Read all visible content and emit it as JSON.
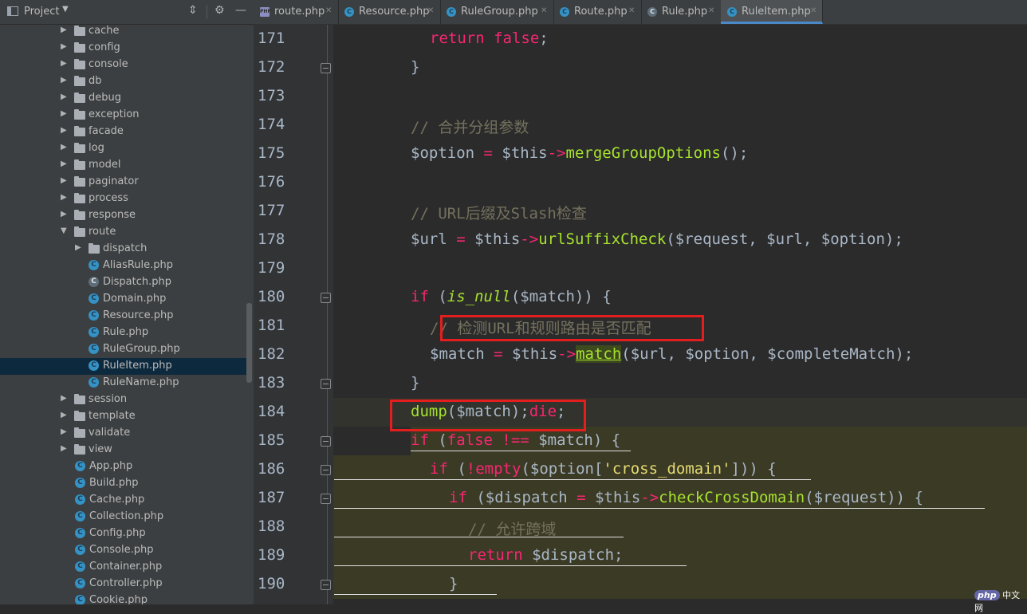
{
  "project": {
    "title": "Project",
    "tree": [
      {
        "type": "folder",
        "label": "cache",
        "depth": 0,
        "collapsed": true
      },
      {
        "type": "folder",
        "label": "config",
        "depth": 0,
        "collapsed": true
      },
      {
        "type": "folder",
        "label": "console",
        "depth": 0,
        "collapsed": true
      },
      {
        "type": "folder",
        "label": "db",
        "depth": 0,
        "collapsed": true
      },
      {
        "type": "folder",
        "label": "debug",
        "depth": 0,
        "collapsed": true
      },
      {
        "type": "folder",
        "label": "exception",
        "depth": 0,
        "collapsed": true
      },
      {
        "type": "folder",
        "label": "facade",
        "depth": 0,
        "collapsed": true
      },
      {
        "type": "folder",
        "label": "log",
        "depth": 0,
        "collapsed": true
      },
      {
        "type": "folder",
        "label": "model",
        "depth": 0,
        "collapsed": true
      },
      {
        "type": "folder",
        "label": "paginator",
        "depth": 0,
        "collapsed": true
      },
      {
        "type": "folder",
        "label": "process",
        "depth": 0,
        "collapsed": true
      },
      {
        "type": "folder",
        "label": "response",
        "depth": 0,
        "collapsed": true
      },
      {
        "type": "folder",
        "label": "route",
        "depth": 0,
        "collapsed": false
      },
      {
        "type": "folder",
        "label": "dispatch",
        "depth": 1,
        "collapsed": true
      },
      {
        "type": "class",
        "label": "AliasRule.php",
        "depth": 1
      },
      {
        "type": "abstract",
        "label": "Dispatch.php",
        "depth": 1
      },
      {
        "type": "class",
        "label": "Domain.php",
        "depth": 1
      },
      {
        "type": "class",
        "label": "Resource.php",
        "depth": 1
      },
      {
        "type": "class",
        "label": "Rule.php",
        "depth": 1
      },
      {
        "type": "class",
        "label": "RuleGroup.php",
        "depth": 1
      },
      {
        "type": "class",
        "label": "RuleItem.php",
        "depth": 1,
        "selected": true
      },
      {
        "type": "class",
        "label": "RuleName.php",
        "depth": 1
      },
      {
        "type": "folder",
        "label": "session",
        "depth": 0,
        "collapsed": true
      },
      {
        "type": "folder",
        "label": "template",
        "depth": 0,
        "collapsed": true
      },
      {
        "type": "folder",
        "label": "validate",
        "depth": 0,
        "collapsed": true
      },
      {
        "type": "folder",
        "label": "view",
        "depth": 0,
        "collapsed": true
      },
      {
        "type": "class",
        "label": "App.php",
        "depth": 0,
        "file": true
      },
      {
        "type": "class",
        "label": "Build.php",
        "depth": 0,
        "file": true
      },
      {
        "type": "class",
        "label": "Cache.php",
        "depth": 0,
        "file": true
      },
      {
        "type": "class",
        "label": "Collection.php",
        "depth": 0,
        "file": true
      },
      {
        "type": "class",
        "label": "Config.php",
        "depth": 0,
        "file": true
      },
      {
        "type": "class",
        "label": "Console.php",
        "depth": 0,
        "file": true
      },
      {
        "type": "class",
        "label": "Container.php",
        "depth": 0,
        "file": true
      },
      {
        "type": "class",
        "label": "Controller.php",
        "depth": 0,
        "file": true
      },
      {
        "type": "class",
        "label": "Cookie.php",
        "depth": 0,
        "file": true
      }
    ]
  },
  "tabs": [
    {
      "label": "route.php",
      "icon": "php-file-icon",
      "active": false
    },
    {
      "label": "Resource.php",
      "icon": "class-icon",
      "active": false
    },
    {
      "label": "RuleGroup.php",
      "icon": "class-icon",
      "active": false
    },
    {
      "label": "Route.php",
      "icon": "class-icon",
      "active": false
    },
    {
      "label": "Rule.php",
      "icon": "abstract-class-icon",
      "active": false
    },
    {
      "label": "RuleItem.php",
      "icon": "class-icon",
      "active": true
    }
  ],
  "editor": {
    "lines": [
      {
        "n": "171",
        "indent": 10,
        "tokens": [
          [
            "kw2",
            "return "
          ],
          [
            "kw2",
            "false"
          ],
          [
            "var",
            ";"
          ]
        ]
      },
      {
        "n": "172",
        "indent": 8,
        "fold": true,
        "tokens": [
          [
            "var",
            "}"
          ]
        ]
      },
      {
        "n": "173",
        "indent": 8,
        "tokens": []
      },
      {
        "n": "174",
        "indent": 8,
        "tokens": [
          [
            "cm",
            "// 合并分组参数"
          ]
        ]
      },
      {
        "n": "175",
        "indent": 8,
        "tokens": [
          [
            "var",
            "$option "
          ],
          [
            "op",
            "= "
          ],
          [
            "var",
            "$this"
          ],
          [
            "op",
            "->"
          ],
          [
            "fn",
            "mergeGroupOptions"
          ],
          [
            "var",
            "();"
          ]
        ]
      },
      {
        "n": "176",
        "indent": 8,
        "tokens": []
      },
      {
        "n": "177",
        "indent": 8,
        "tokens": [
          [
            "cm",
            "// URL后缀及Slash检查"
          ]
        ]
      },
      {
        "n": "178",
        "indent": 8,
        "tokens": [
          [
            "var",
            "$url "
          ],
          [
            "op",
            "= "
          ],
          [
            "var",
            "$this"
          ],
          [
            "op",
            "->"
          ],
          [
            "fn",
            "urlSuffixCheck"
          ],
          [
            "var",
            "($request, $url, $option);"
          ]
        ]
      },
      {
        "n": "179",
        "indent": 8,
        "tokens": []
      },
      {
        "n": "180",
        "indent": 8,
        "fold": true,
        "tokens": [
          [
            "kw2",
            "if "
          ],
          [
            "var",
            "("
          ],
          [
            "fni",
            "is_null"
          ],
          [
            "var",
            "($match)) {"
          ]
        ]
      },
      {
        "n": "181",
        "indent": 10,
        "tokens": [
          [
            "cm",
            "// 检测URL和规则路由是否匹配"
          ]
        ]
      },
      {
        "n": "182",
        "indent": 10,
        "tokens": [
          [
            "var",
            "$match "
          ],
          [
            "op",
            "= "
          ],
          [
            "var",
            "$this"
          ],
          [
            "op",
            "->"
          ],
          [
            "fnu",
            "match"
          ],
          [
            "var",
            "($url, $option, $completeMatch);"
          ]
        ]
      },
      {
        "n": "183",
        "indent": 8,
        "fold": true,
        "tokens": [
          [
            "var",
            "}"
          ]
        ]
      },
      {
        "n": "184",
        "indent": 8,
        "current": true,
        "tokens": [
          [
            "fn",
            "dump"
          ],
          [
            "var",
            "($match);"
          ],
          [
            "kw2",
            "die"
          ],
          [
            "var",
            ";"
          ]
        ]
      },
      {
        "n": "185",
        "indent": 8,
        "fold": true,
        "tokens": [
          [
            "kw2",
            "if "
          ],
          [
            "var",
            "("
          ],
          [
            "kw2",
            "false "
          ],
          [
            "op",
            "!== "
          ],
          [
            "var",
            "$match) {"
          ]
        ]
      },
      {
        "n": "186",
        "indent": 10,
        "fold": true,
        "tokens": [
          [
            "kw2",
            "if "
          ],
          [
            "var",
            "("
          ],
          [
            "op",
            "!"
          ],
          [
            "kw2",
            "empty"
          ],
          [
            "var",
            "($option["
          ],
          [
            "str",
            "'cross_domain'"
          ],
          [
            "var",
            "])) {"
          ]
        ]
      },
      {
        "n": "187",
        "indent": 12,
        "fold": true,
        "tokens": [
          [
            "kw2",
            "if "
          ],
          [
            "var",
            "($dispatch "
          ],
          [
            "op",
            "= "
          ],
          [
            "var",
            "$this"
          ],
          [
            "op",
            "->"
          ],
          [
            "fn",
            "checkCrossDomain"
          ],
          [
            "var",
            "($request)) {"
          ]
        ]
      },
      {
        "n": "188",
        "indent": 14,
        "tokens": [
          [
            "cm",
            "// 允许跨域"
          ]
        ]
      },
      {
        "n": "189",
        "indent": 14,
        "tokens": [
          [
            "kw2",
            "return "
          ],
          [
            "var",
            "$dispatch;"
          ]
        ]
      },
      {
        "n": "190",
        "indent": 12,
        "fold": true,
        "tokens": [
          [
            "var",
            "}"
          ]
        ]
      }
    ]
  },
  "watermark": {
    "logo": "php",
    "text": "中文网"
  }
}
